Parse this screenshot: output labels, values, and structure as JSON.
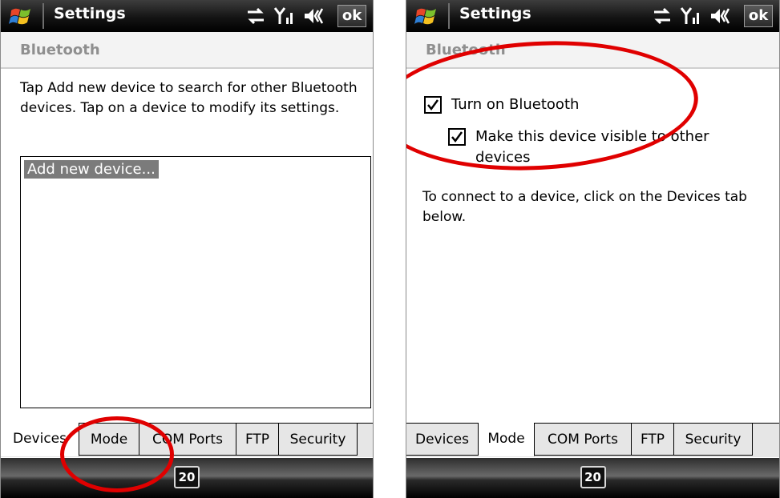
{
  "left_screen": {
    "title": "Settings",
    "ok_label": "ok",
    "section": "Bluetooth",
    "description": "Tap Add new device to search for other Bluetooth devices. Tap on a device to modify its settings.",
    "list_items": [
      "Add new device..."
    ],
    "tabs": [
      "Devices",
      "Mode",
      "COM Ports",
      "FTP",
      "Security"
    ],
    "active_tab": "Devices",
    "keyboard_label": "20"
  },
  "right_screen": {
    "title": "Settings",
    "ok_label": "ok",
    "section": "Bluetooth",
    "turn_on_label": "Turn on Bluetooth",
    "turn_on_checked": true,
    "visible_label_line1": "Make this device visible to other",
    "visible_label_line2": "devices",
    "visible_checked": true,
    "connect_text": "To connect to a device, click on the Devices tab below.",
    "tabs": [
      "Devices",
      "Mode",
      "COM Ports",
      "FTP",
      "Security"
    ],
    "active_tab": "Mode",
    "keyboard_label": "20"
  },
  "annotation_color": "#e00000"
}
